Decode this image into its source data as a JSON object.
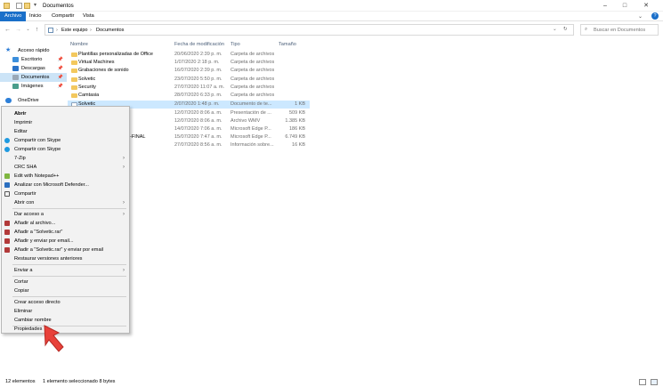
{
  "window": {
    "title": "Documentos"
  },
  "ribbon": {
    "tabs": [
      "Archivo",
      "Inicio",
      "Compartir",
      "Vista"
    ]
  },
  "address": {
    "path": [
      "Este equipo",
      "Documentos"
    ],
    "search_placeholder": "Buscar en Documentos"
  },
  "nav_pane": {
    "items": [
      {
        "label": "Acceso rápido"
      },
      {
        "label": "Escritorio"
      },
      {
        "label": "Descargas"
      },
      {
        "label": "Documentos"
      },
      {
        "label": "Imágenes"
      },
      {
        "label": "OneDrive"
      }
    ]
  },
  "columns": {
    "name": "Nombre",
    "date": "Fecha de modificación",
    "type": "Tipo",
    "size": "Tamaño"
  },
  "files": [
    {
      "name": "Plantillas personalizadas de Office",
      "date": "20/06/2020 2:39 p. m.",
      "type": "Carpeta de archivos",
      "size": ""
    },
    {
      "name": "Virtual Machines",
      "date": "1/07/2020 2:18 p. m.",
      "type": "Carpeta de archivos",
      "size": ""
    },
    {
      "name": "Grabaciones de sonido",
      "date": "16/07/2020 2:39 p. m.",
      "type": "Carpeta de archivos",
      "size": ""
    },
    {
      "name": "Solvetic",
      "date": "23/07/2020 5:50 p. m.",
      "type": "Carpeta de archivos",
      "size": ""
    },
    {
      "name": "Security",
      "date": "27/07/2020 11:07 a. m.",
      "type": "Carpeta de archivos",
      "size": ""
    },
    {
      "name": "Camtasia",
      "date": "28/07/2020 6:33 p. m.",
      "type": "Carpeta de archivos",
      "size": ""
    },
    {
      "name": "Solvetic",
      "date": "2/07/2020 1:48 p. m.",
      "type": "Documento de te...",
      "size": "1 KB"
    },
    {
      "name": "",
      "date": "12/07/2020 8:06 a. m.",
      "type": "Presentación de ...",
      "size": "509 KB"
    },
    {
      "name": "",
      "date": "12/07/2020 8:06 a. m.",
      "type": "Archivo WMV",
      "size": "1.385 KB"
    },
    {
      "name": "",
      "date": "14/07/2020 7:06 a. m.",
      "type": "Microsoft Edge P...",
      "size": "186 KB"
    },
    {
      "name": "-FINAL",
      "date": "15/07/2020 7:47 a. m.",
      "type": "Microsoft Edge P...",
      "size": "6.749 KB"
    },
    {
      "name": "",
      "date": "27/07/2020 8:56 a. m.",
      "type": "Información sobre...",
      "size": "16 KB"
    }
  ],
  "context_menu": {
    "items": [
      "Abrir",
      "Imprimir",
      "Editar",
      "Compartir con Skype",
      "Compartir con Skype",
      "7-Zip",
      "CRC SHA",
      "Edit with Notepad++",
      "Analizar con Microsoft Defender...",
      "Compartir",
      "Abrir con",
      "Dar acceso a",
      "Añadir al archivo...",
      "Añadir a \"Solvetic.rar\"",
      "Añadir y enviar por email...",
      "Añadir a \"Solvetic.rar\" y enviar por email",
      "Restaurar versiones anteriores",
      "Enviar a",
      "Cortar",
      "Copiar",
      "Crear acceso directo",
      "Eliminar",
      "Cambiar nombre",
      "Propiedades"
    ]
  },
  "status": {
    "count": "12 elementos",
    "selection": "1 elemento seleccionado 8 bytes"
  },
  "colors": {
    "accent": "#1a6fc9",
    "selection": "#cce8ff",
    "folder": "#f3c85e",
    "pointer": "#e8413a"
  }
}
